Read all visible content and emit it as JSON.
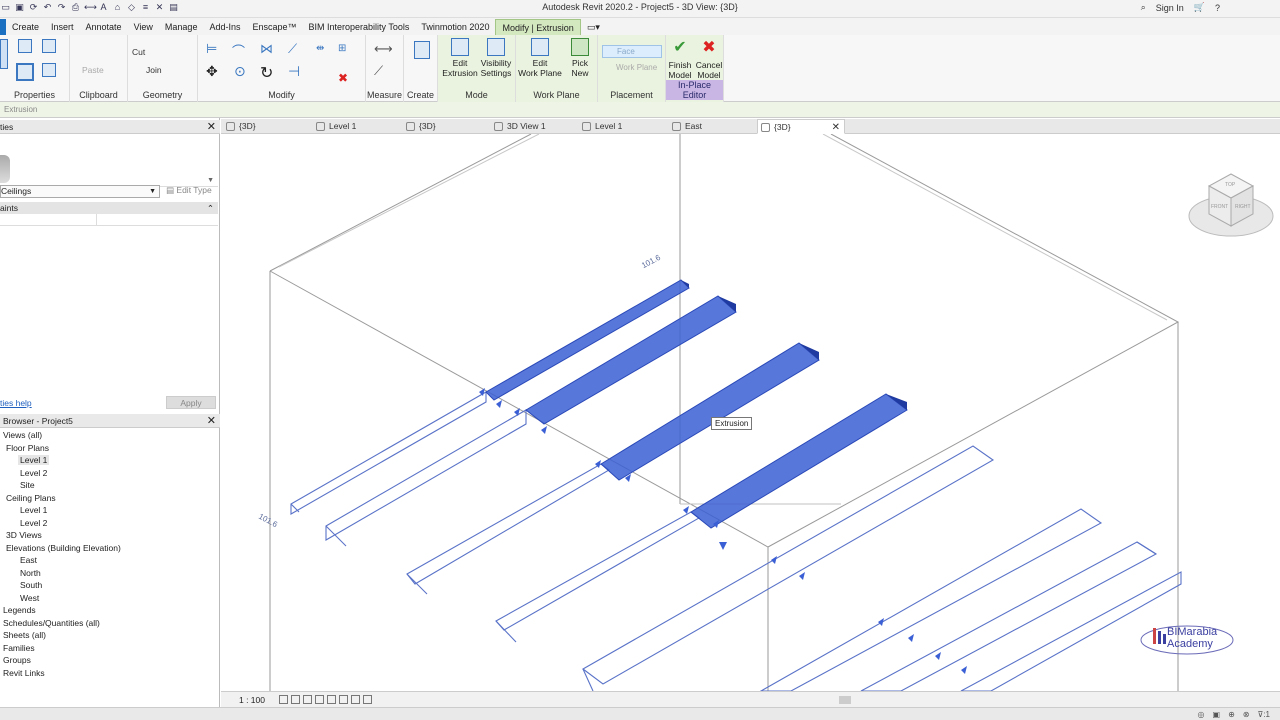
{
  "window": {
    "title": "Autodesk Revit 2020.2 - Project5 - 3D View: {3D}",
    "sign_in": "Sign In"
  },
  "ribbon_tabs": [
    "Create",
    "Insert",
    "Annotate",
    "View",
    "Manage",
    "Add-Ins",
    "Enscape™",
    "BIM Interoperability Tools",
    "Twinmotion 2020",
    "Modify | Extrusion"
  ],
  "ribbon": {
    "panels": {
      "properties": "Properties",
      "clipboard": "Clipboard",
      "geometry": "Geometry",
      "modify": "Modify",
      "measure": "Measure",
      "create": "Create",
      "mode": "Mode",
      "work_plane": "Work Plane",
      "placement": "Placement",
      "in_place_editor": "In-Place Editor"
    },
    "paste": "Paste",
    "cut": "Cut",
    "join": "Join",
    "edit_extrusion_1": "Edit",
    "edit_extrusion_2": "Extrusion",
    "visibility_settings_1": "Visibility",
    "visibility_settings_2": "Settings",
    "edit_work_plane_1": "Edit",
    "edit_work_plane_2": "Work Plane",
    "pick_new_1": "Pick",
    "pick_new_2": "New",
    "face": "Face",
    "work_plane_opt": "Work Plane",
    "finish_model_1": "Finish",
    "finish_model_2": "Model",
    "cancel_model_1": "Cancel",
    "cancel_model_2": "Model"
  },
  "options_bar": "Extrusion",
  "properties_panel": {
    "header": "ties",
    "family": "Ceilings",
    "edit_type": "Edit Type",
    "constraints": "aints",
    "help_link": "ties help",
    "apply": "Apply"
  },
  "project_browser": {
    "header": "Browser - Project5",
    "items": [
      {
        "label": "Views (all)"
      },
      {
        "label": "Floor Plans"
      },
      {
        "label": "Level 1"
      },
      {
        "label": "Level 2"
      },
      {
        "label": "Site"
      },
      {
        "label": "Ceiling Plans"
      },
      {
        "label": "Level 1"
      },
      {
        "label": "Level 2"
      },
      {
        "label": "3D Views"
      },
      {
        "label": "Elevations (Building Elevation)"
      },
      {
        "label": "East"
      },
      {
        "label": "North"
      },
      {
        "label": "South"
      },
      {
        "label": "West"
      },
      {
        "label": "Legends"
      },
      {
        "label": "Schedules/Quantities (all)"
      },
      {
        "label": "Sheets (all)"
      },
      {
        "label": "Families"
      },
      {
        "label": "Groups"
      },
      {
        "label": "Revit Links"
      }
    ]
  },
  "view_tabs": [
    "{3D}",
    "Level 1",
    "{3D}",
    "3D View 1",
    "Level 1",
    "East",
    "{3D}"
  ],
  "canvas": {
    "tooltip": "Extrusion",
    "dim_top": "101.6",
    "dim_bottom": "101.6",
    "viewcube_top": "TOP",
    "viewcube_front": "FRONT",
    "viewcube_right": "RIGHT"
  },
  "watermark": {
    "line1": "BIMarabia",
    "line2": "Academy"
  },
  "view_control": {
    "scale": "1 : 100"
  },
  "status": {
    "filter": ":1"
  },
  "colors": {
    "accent": "#1b70c2",
    "selected_fill": "#3b5fd4",
    "context_tab": "#d4e8c0"
  }
}
